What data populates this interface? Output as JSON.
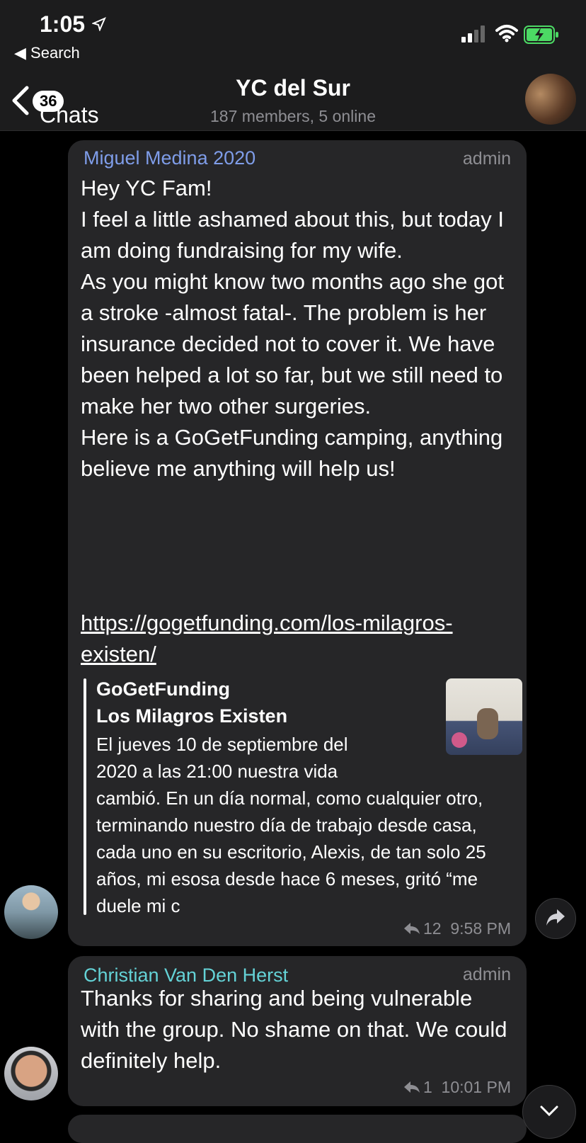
{
  "status_bar": {
    "time": "1:05",
    "back_app": "Search"
  },
  "header": {
    "back_label": "Chats",
    "unread_badge": "36",
    "title": "YC del Sur",
    "subtitle": "187 members, 5 online"
  },
  "messages": [
    {
      "sender": "Miguel Medina 2020",
      "role": "admin",
      "text": "Hey YC Fam!\nI feel a little ashamed about this, but today I am doing fundraising for my wife.\nAs you might know two months ago she got a stroke -almost fatal-. The problem is her insurance decided not to cover it. We have been helped a lot so far, but we still need to make her two other surgeries.\nHere is a GoGetFunding camping, anything believe me anything will help us!",
      "link": "https://gogetfunding.com/los-milagros-existen/",
      "preview": {
        "site": "GoGetFunding",
        "title": "Los Milagros Existen",
        "description": "El jueves 10 de septiembre del\n2020 a las 21:00 nuestra vida\ncambió. En un día normal, como cualquier otro, terminando nuestro día de trabajo desde casa, cada uno en su escritorio, Alexis, de tan solo 25 años, mi esosa desde hace 6 meses, gritó “me duele mi c"
      },
      "replies": "12",
      "time": "9:58 PM"
    },
    {
      "sender": "Christian Van Den Herst",
      "role": "admin",
      "text": "Thanks for sharing and being vulnerable with the group. No shame on that. We could definitely help.",
      "replies": "1",
      "time": "10:01 PM"
    }
  ],
  "colors": {
    "background": "#000000",
    "bubble": "#262628",
    "sender1": "#7f9de9",
    "sender2": "#64d2d6",
    "meta": "#8e8e93"
  },
  "icons": [
    "location-arrow-icon",
    "signal-icon",
    "wifi-icon",
    "battery-charging-icon",
    "back-chevron-icon",
    "reply-icon",
    "share-icon",
    "chevron-down-icon"
  ]
}
